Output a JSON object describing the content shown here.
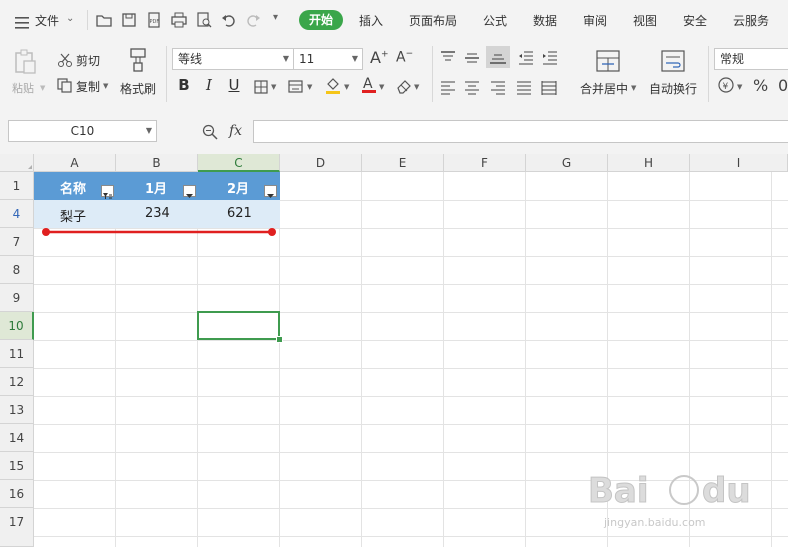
{
  "menubar": {
    "file_label": "文件",
    "tabs": [
      "开始",
      "插入",
      "页面布局",
      "公式",
      "数据",
      "审阅",
      "视图",
      "安全",
      "云服务"
    ]
  },
  "ribbon": {
    "paste_label": "粘贴",
    "cut_label": "剪切",
    "copy_label": "复制",
    "format_painter_label": "格式刷",
    "font_name": "等线",
    "font_size": "11",
    "bold": "B",
    "italic": "I",
    "underline": "U",
    "merge_label": "合并居中",
    "wrap_label": "自动换行",
    "number_format": "常规",
    "percent": "%"
  },
  "formulabar": {
    "name_box": "C10",
    "fx_label": "fx",
    "formula": ""
  },
  "grid": {
    "columns": [
      "A",
      "B",
      "C",
      "D",
      "E",
      "F",
      "G",
      "H",
      "I"
    ],
    "selected_column": "C",
    "rows": [
      "1",
      "4",
      "7",
      "8",
      "9",
      "10",
      "11",
      "12",
      "13",
      "14",
      "15",
      "16",
      "17"
    ],
    "selected_row": "10",
    "header_cells": [
      "名称",
      "1月",
      "2月"
    ],
    "data_row": [
      "梨子",
      "234",
      "621"
    ],
    "active_cell": "C10"
  },
  "colors": {
    "header_fill": "#5b9bd5",
    "data_fill": "#ddebf7",
    "accent_green": "#3aa64a",
    "annotation_red": "#e02020"
  }
}
